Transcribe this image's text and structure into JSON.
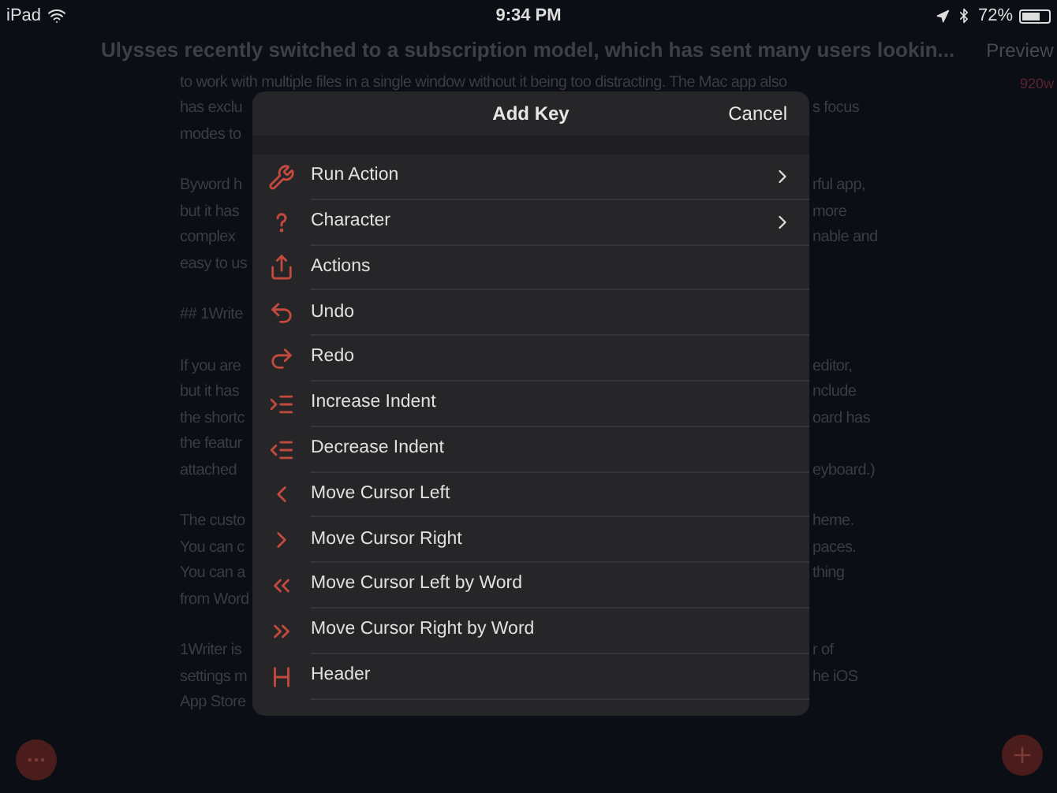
{
  "status_bar": {
    "device": "iPad",
    "time": "9:34 PM",
    "battery": "72%"
  },
  "toolbar": {
    "title": "Ulysses recently switched to a subscription model, which has sent many users lookin...",
    "preview": "Preview"
  },
  "word_count": "920w",
  "document_lines": [
    {
      "left": "to work with multiple files in a single window without it being too distracting. The Mac app also",
      "gap_before": false
    },
    {
      "left": "has exclu",
      "right": "s focus",
      "gap_before": false
    },
    {
      "left": "modes to",
      "gap_before": false
    },
    {
      "left": "Byword h",
      "right": "rful app,",
      "gap_before": true
    },
    {
      "left": "but it has",
      "right": "more",
      "gap_before": false
    },
    {
      "left": "complex",
      "right": "nable and",
      "gap_before": false
    },
    {
      "left": "easy to us",
      "gap_before": false
    },
    {
      "left": "## 1Write",
      "gap_before": true
    },
    {
      "left": "If you are",
      "right": "editor,",
      "gap_before": true
    },
    {
      "left": "but it has",
      "right": "nclude",
      "gap_before": false
    },
    {
      "left": "the shortc",
      "right": "oard has",
      "gap_before": false
    },
    {
      "left": "the featur",
      "gap_before": false
    },
    {
      "left": "attached",
      "right": "eyboard.)",
      "gap_before": false
    },
    {
      "left": "The custo",
      "right": "heme.",
      "gap_before": true
    },
    {
      "left": "You can c",
      "right": "paces.",
      "gap_before": false
    },
    {
      "left": "You can a",
      "right": "thing",
      "gap_before": false
    },
    {
      "left": "from Word",
      "gap_before": false
    },
    {
      "left": "1Writer is",
      "right": "r of",
      "gap_before": true
    },
    {
      "left": "settings m",
      "right": "he iOS",
      "gap_before": false
    },
    {
      "left": "App Store",
      "gap_before": false
    }
  ],
  "dialog": {
    "title": "Add Key",
    "cancel": "Cancel",
    "items": [
      {
        "label": "Run Action",
        "submenu": true
      },
      {
        "label": "Character",
        "submenu": true
      },
      {
        "label": "Actions",
        "submenu": false
      },
      {
        "label": "Undo",
        "submenu": false
      },
      {
        "label": "Redo",
        "submenu": false
      },
      {
        "label": "Increase Indent",
        "submenu": false
      },
      {
        "label": "Decrease Indent",
        "submenu": false
      },
      {
        "label": "Move Cursor Left",
        "submenu": false
      },
      {
        "label": "Move Cursor Right",
        "submenu": false
      },
      {
        "label": "Move Cursor Left by Word",
        "submenu": false
      },
      {
        "label": "Move Cursor Right by Word",
        "submenu": false
      },
      {
        "label": "Header",
        "submenu": false
      }
    ]
  }
}
